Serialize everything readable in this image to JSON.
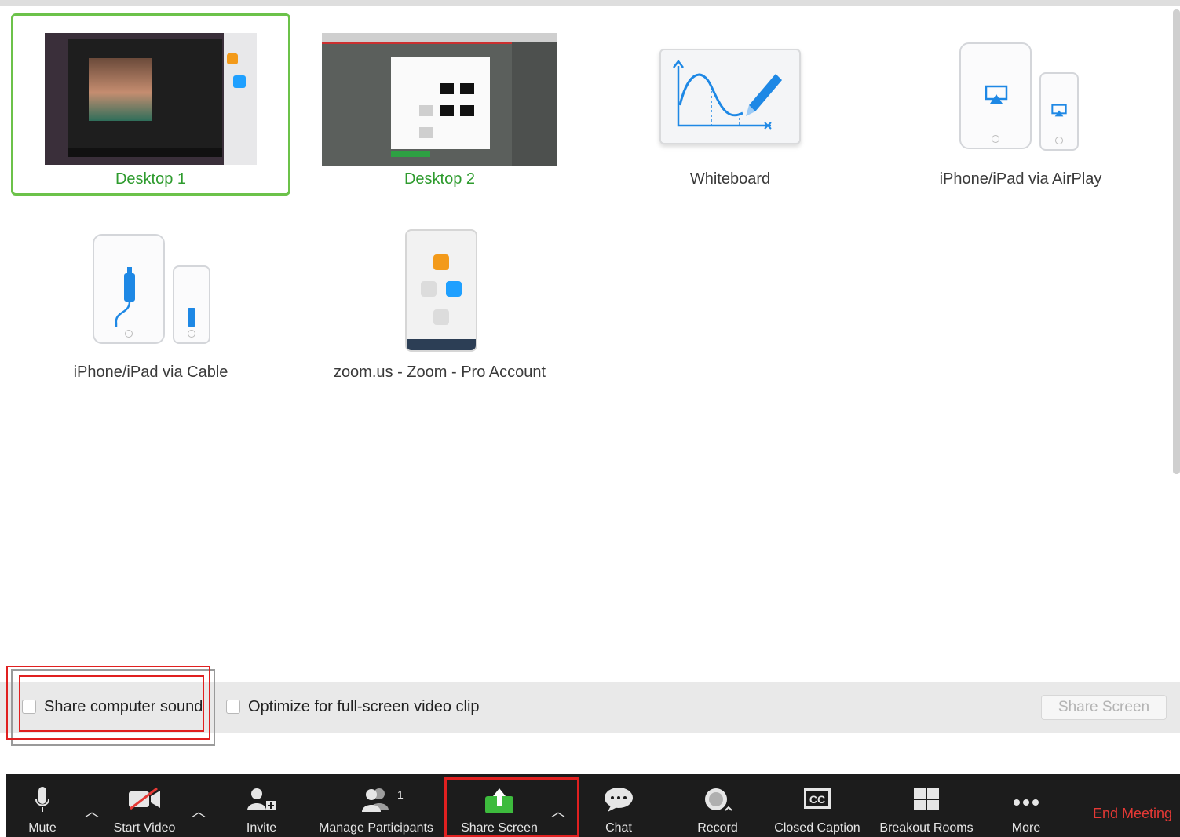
{
  "share_options": {
    "row1": [
      {
        "label": "Desktop 1",
        "icon": "desktop-thumbnail",
        "selected": true
      },
      {
        "label": "Desktop 2",
        "icon": "desktop-thumbnail",
        "selected": false
      },
      {
        "label": "Whiteboard",
        "icon": "whiteboard-icon",
        "selected": false
      },
      {
        "label": "iPhone/iPad via AirPlay",
        "icon": "airplay-devices-icon",
        "selected": false
      }
    ],
    "row2": [
      {
        "label": "iPhone/iPad via Cable",
        "icon": "cable-devices-icon",
        "selected": false
      },
      {
        "label": "zoom.us - Zoom - Pro Account",
        "icon": "app-window-thumbnail",
        "selected": false
      }
    ]
  },
  "options_bar": {
    "share_sound_label": "Share computer sound",
    "share_sound_checked": false,
    "optimize_label": "Optimize for full-screen video clip",
    "optimize_checked": false,
    "share_screen_button": "Share Screen"
  },
  "toolbar": {
    "mute": "Mute",
    "start_video": "Start Video",
    "invite": "Invite",
    "manage_participants": "Manage Participants",
    "participant_count": "1",
    "share_screen": "Share Screen",
    "chat": "Chat",
    "record": "Record",
    "closed_caption": "Closed Caption",
    "breakout_rooms": "Breakout Rooms",
    "more": "More",
    "end_meeting": "End Meeting"
  },
  "colors": {
    "selected_green": "#6cc24a",
    "label_green": "#2e9b2e",
    "highlight_red": "#e02020",
    "end_meeting_red": "#e53935",
    "toolbar_bg": "#1c1c1c",
    "share_green": "#3dbb3d"
  }
}
